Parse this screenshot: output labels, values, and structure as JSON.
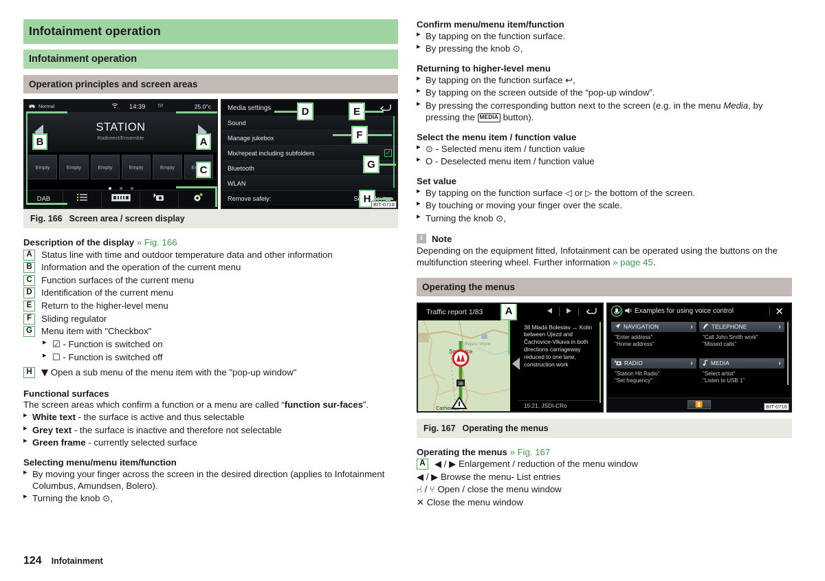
{
  "document": {
    "page_number": "124",
    "footer_section": "Infotainment"
  },
  "left_column": {
    "heading_1": "Infotainment operation",
    "heading_2": "Infotainment operation",
    "heading_3": "Operation principles and screen areas",
    "figure_166": {
      "caption_number": "Fig. 166",
      "caption_text": "Screen area / screen display",
      "image_code": "BIT-0718",
      "callouts": [
        "A",
        "B",
        "C",
        "D",
        "E",
        "F",
        "G",
        "H"
      ],
      "left_screen": {
        "status_drive_mode": "Normal",
        "status_time": "14:39",
        "status_tp": "TP",
        "status_temperature": "25.0°c",
        "station_title": "STATION",
        "station_subtitle": "Radiotext/Ensemble",
        "presets": [
          "Empty",
          "Empty",
          "Empty",
          "Empty",
          "Empty",
          "Empty"
        ],
        "bottom_bar": [
          "DAB",
          "list-icon",
          "cassette-icon",
          "traffic-icon",
          "settings-gear-icon"
        ]
      },
      "right_screen": {
        "title": "Media settings",
        "items": [
          {
            "label": "Sound",
            "value": ""
          },
          {
            "label": "Manage jukebox",
            "value": ""
          },
          {
            "label": "Mix/repeat including subfolders",
            "value": "checkbox-checked"
          },
          {
            "label": "Bluetooth",
            "value": ""
          },
          {
            "label": "WLAN",
            "value": ""
          },
          {
            "label": "Remove safely:",
            "value": "Select device"
          }
        ]
      }
    },
    "description": {
      "title": "Description of the display",
      "reference": "» Fig. 166",
      "items": [
        {
          "key": "A",
          "text": "Status line with time and outdoor temperature data and other information"
        },
        {
          "key": "B",
          "text": "Information and the operation of the current menu"
        },
        {
          "key": "C",
          "text": "Function surfaces of the current menu"
        },
        {
          "key": "D",
          "text": "Identification of the current menu"
        },
        {
          "key": "E",
          "text": "Return to the higher-level menu"
        },
        {
          "key": "F",
          "text": "Sliding regulator"
        },
        {
          "key": "G",
          "text": "Menu item with \"Checkbox\""
        }
      ],
      "g_sub_items": [
        "- Function is switched on",
        "- Function is switched off"
      ],
      "h_key": "H",
      "h_text": "Open a sub menu of the menu item with the \"pop-up window\""
    },
    "functional_surfaces": {
      "title": "Functional surfaces",
      "intro_part1": "The screen areas which confirm a function or a menu are called “",
      "intro_bold": "function sur-",
      "intro_bold2": "faces",
      "intro_part2": "”.",
      "bullets": [
        {
          "bold": "White text",
          "rest": " - the surface is active and thus selectable"
        },
        {
          "bold": "Grey text",
          "rest": " - the surface is inactive and therefore not selectable"
        },
        {
          "bold": "Green frame",
          "rest": " - currently selected surface"
        }
      ]
    },
    "selecting": {
      "title": "Selecting menu/menu item/function",
      "bullets": [
        "By moving your finger across the screen in the desired direction (applies to Infotainment Columbus, Amundsen, Bolero).",
        "Turning the knob ⊙,"
      ]
    }
  },
  "right_column": {
    "confirm": {
      "title": "Confirm menu/menu item/function",
      "bullets": [
        "By tapping on the function surface.",
        "By pressing the knob ⊙,"
      ]
    },
    "returning": {
      "title": "Returning to higher-level menu",
      "bullet1": "By tapping on the function surface ↩,",
      "bullet2": "By tapping on the screen outside of the “pop-up window”.",
      "bullet3_a": "By pressing the corresponding button next to the screen (e.g. in the menu ",
      "bullet3_italic": "Media",
      "bullet3_b": ", by pressing the ",
      "bullet3_button": "MEDIA",
      "bullet3_c": " button)."
    },
    "select_value": {
      "title": "Select the menu item / function value",
      "bullet1": "⊙ - Selected menu item / function value",
      "bullet2": "O - Deselected menu item / function value"
    },
    "set_value": {
      "title": "Set value",
      "bullets": [
        "By tapping on the function surface ◁ or ▷ the bottom of the screen.",
        "By touching or moving your finger over the scale.",
        "Turning the knob ⊙,"
      ]
    },
    "note": {
      "icon": "info-icon",
      "title": "Note",
      "text_part1": "Depending on the equipment fitted, Infotainment can be operated using the buttons on the multifunction steering wheel. Further information ",
      "reference": "» page 45",
      "text_part2": "."
    },
    "heading_operating": "Operating the menus",
    "figure_167": {
      "caption_number": "Fig. 167",
      "caption_text": "Operating the menus",
      "image_code": "BIT-0716",
      "callout": "A",
      "nav_screen": {
        "title": "Traffic report 1/83",
        "map_labels": [
          "Smilovice",
          "Rejsicc Wrynk",
          "Carhovice",
          "38"
        ],
        "traffic_text": "38 Mladá Boleslav ↔ Kolin between Újezd and Čachovice-Vlkava in both directions carriageway reduced to one lane, construction work",
        "timestamp": "15:21, JSDI-CRo"
      },
      "voice_screen": {
        "title": "Examples for using voice control",
        "cells": [
          {
            "icon": "navigation-arrow-icon",
            "label": "NAVIGATION",
            "examples": [
              "\"Enter address\"",
              "\"Home address\""
            ]
          },
          {
            "icon": "telephone-icon",
            "label": "TELEPHONE",
            "examples": [
              "\"Call John Smith work\"",
              "\"Missed calls\""
            ]
          },
          {
            "icon": "radio-icon",
            "label": "RADIO",
            "examples": [
              "\"Station Hit Radio\"",
              "\"Set frequency\""
            ]
          },
          {
            "icon": "music-note-icon",
            "label": "MEDIA",
            "examples": [
              "\"Select artist\"",
              "\"Listen to USB 1\""
            ]
          }
        ]
      }
    },
    "operating_desc": {
      "title": "Operating the menus",
      "reference": "» Fig. 167",
      "row_a_key": "A",
      "row_a_text": "◀ / ▶ Enlargement / reduction of the menu window",
      "row_b_text": "◀ / ▶  Browse the menu- List entries",
      "row_c_text": "⑁ / ⑂  Open / close the menu window",
      "row_d_text": "✕   Close the menu window"
    }
  },
  "colors": {
    "heading_green_dark": "#9fd4a0",
    "heading_green_light": "#a9d9aa",
    "heading_grey": "#c2b8b4",
    "caption_bg": "#e8e7e1",
    "reference_green": "#3f9a4f",
    "callout_green": "#7fd18a"
  }
}
